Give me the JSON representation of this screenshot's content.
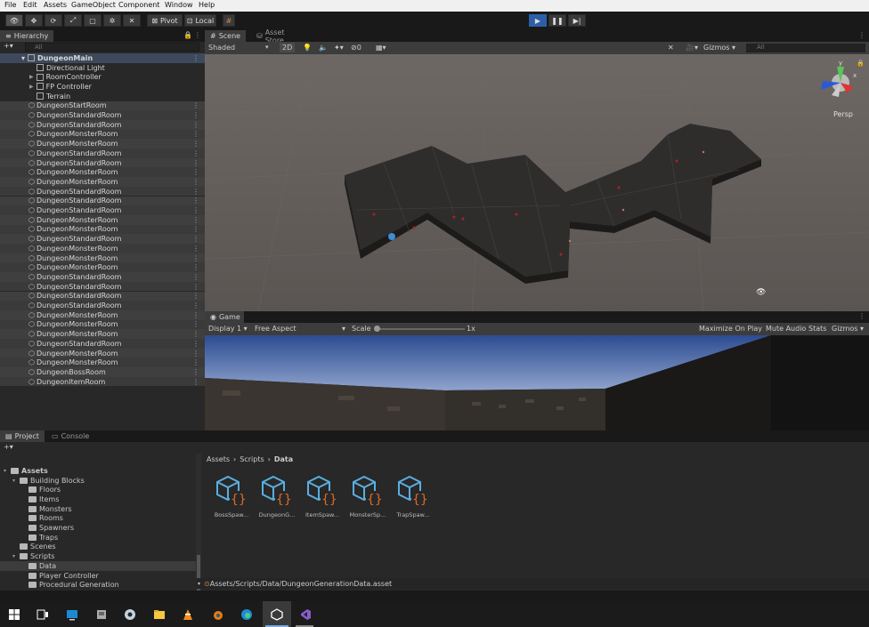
{
  "menu": [
    "File",
    "Edit",
    "Assets",
    "GameObject",
    "Component",
    "Window",
    "Help"
  ],
  "toolbar": {
    "pivot": "Pivot",
    "local": "Local"
  },
  "hierarchy": {
    "tab": "Hierarchy",
    "search_placeholder": "All",
    "root": "DungeonMain",
    "children": [
      "Directional Light",
      "RoomController",
      "FP Controller",
      "Terrain"
    ],
    "rooms": [
      "DungeonStartRoom",
      "DungeonStandardRoom",
      "DungeonStandardRoom",
      "DungeonMonsterRoom",
      "DungeonMonsterRoom",
      "DungeonStandardRoom",
      "DungeonStandardRoom",
      "DungeonMonsterRoom",
      "DungeonMonsterRoom",
      "DungeonStandardRoom",
      "DungeonStandardRoom",
      "DungeonStandardRoom",
      "DungeonMonsterRoom",
      "DungeonMonsterRoom",
      "DungeonStandardRoom",
      "DungeonMonsterRoom",
      "DungeonMonsterRoom",
      "DungeonMonsterRoom",
      "DungeonStandardRoom",
      "DungeonStandardRoom",
      "DungeonStandardRoom",
      "DungeonStandardRoom",
      "DungeonMonsterRoom",
      "DungeonMonsterRoom",
      "DungeonMonsterRoom",
      "DungeonStandardRoom",
      "DungeonMonsterRoom",
      "DungeonMonsterRoom",
      "DungeonBossRoom",
      "DungeonItemRoom"
    ]
  },
  "scene": {
    "tab": "Scene",
    "store_tab": "Asset Store",
    "shading": "Shaded",
    "mode_2d": "2D",
    "hidden_count": "0",
    "gizmos": "Gizmos",
    "search_placeholder": "All",
    "persp": "Persp",
    "axis_y": "y",
    "axis_x": "x"
  },
  "game": {
    "tab": "Game",
    "display": "Display 1",
    "aspect": "Free Aspect",
    "scale_label": "Scale",
    "scale_value": "1x",
    "maximize": "Maximize On Play",
    "mute": "Mute Audio",
    "stats": "Stats",
    "gizmos": "Gizmos"
  },
  "project": {
    "tab": "Project",
    "console_tab": "Console",
    "tree": [
      {
        "label": "Assets",
        "indent": 0
      },
      {
        "label": "Building Blocks",
        "indent": 1
      },
      {
        "label": "Floors",
        "indent": 2
      },
      {
        "label": "Items",
        "indent": 2
      },
      {
        "label": "Monsters",
        "indent": 2
      },
      {
        "label": "Rooms",
        "indent": 2
      },
      {
        "label": "Spawners",
        "indent": 2
      },
      {
        "label": "Traps",
        "indent": 2
      },
      {
        "label": "Scenes",
        "indent": 1
      },
      {
        "label": "Scripts",
        "indent": 1
      },
      {
        "label": "Data",
        "indent": 2
      },
      {
        "label": "Player Controller",
        "indent": 2
      },
      {
        "label": "Procedural Generation",
        "indent": 2
      }
    ],
    "breadcrumb": [
      "Assets",
      "Scripts",
      "Data"
    ],
    "assets": [
      "BossSpaw...",
      "DungeonG...",
      "ItemSpaw...",
      "MonsterSp...",
      "TrapSpaw..."
    ],
    "status_path": "Assets/Scripts/Data/DungeonGenerationData.asset"
  },
  "taskbar": [
    "windows-start",
    "task-view",
    "vmware",
    "vm-manager",
    "steam",
    "file-explorer",
    "vlc",
    "blender",
    "edge",
    "unity",
    "visual-studio"
  ]
}
